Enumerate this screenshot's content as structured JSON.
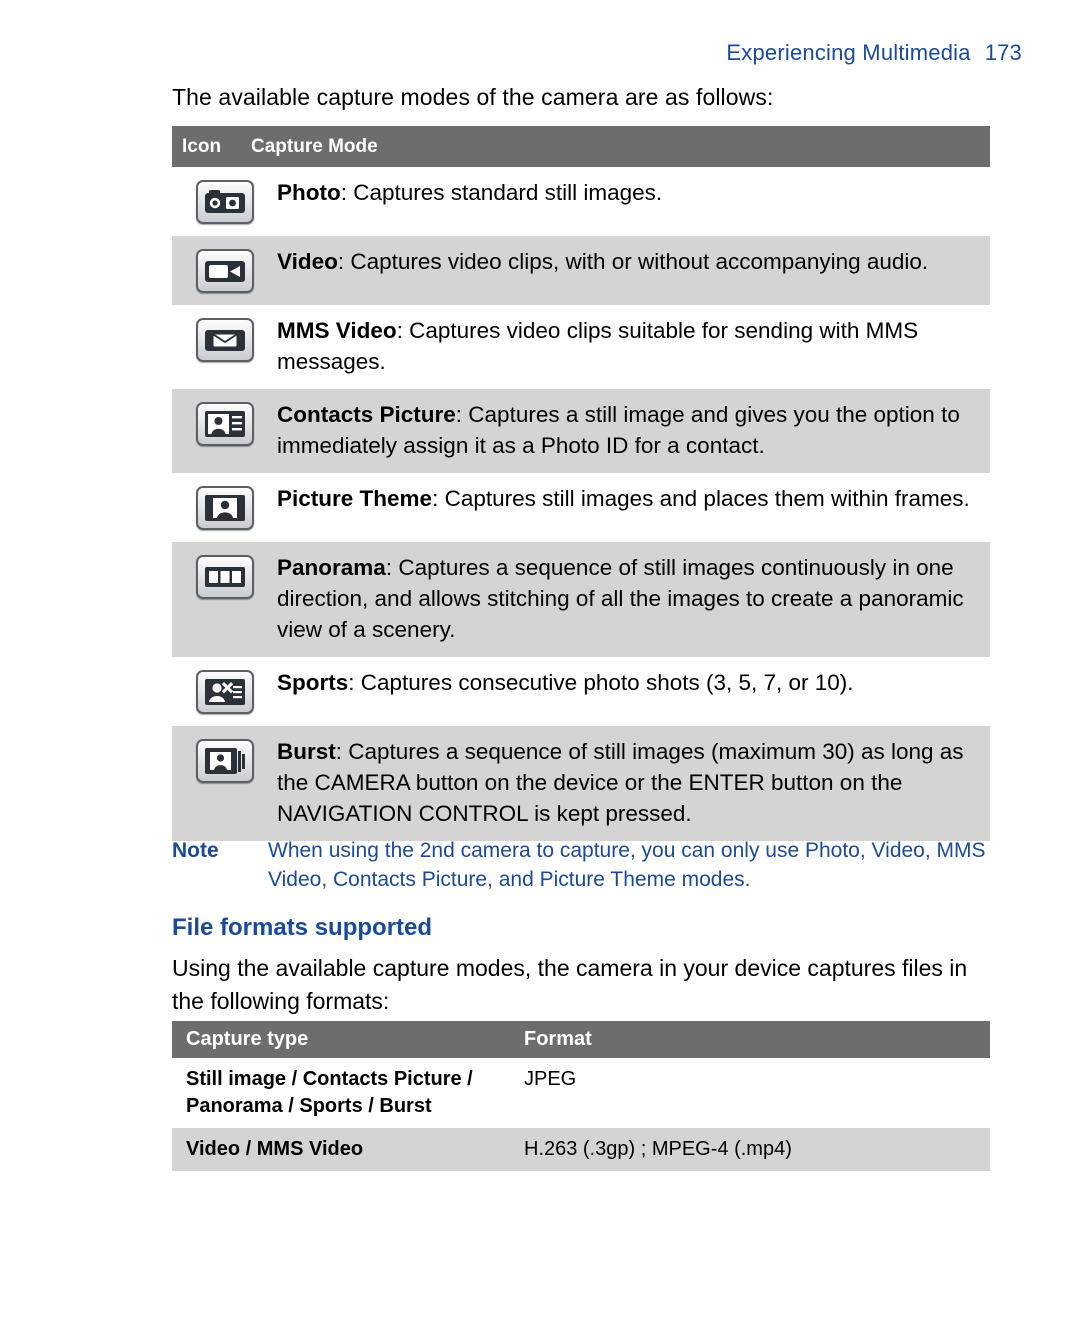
{
  "header": {
    "chapter": "Experiencing Multimedia",
    "page_number": "173"
  },
  "intro": "The available capture modes of the camera are as follows:",
  "modes_table": {
    "headers": {
      "icon": "Icon",
      "mode": "Capture Mode"
    },
    "rows": [
      {
        "icon_name": "photo-camera-icon",
        "term": "Photo",
        "text": ": Captures standard still images."
      },
      {
        "icon_name": "video-camera-icon",
        "term": "Video",
        "text": ": Captures video clips, with or without accompanying audio."
      },
      {
        "icon_name": "mms-video-icon",
        "term": "MMS Video",
        "text": ": Captures video clips suitable for sending with MMS messages."
      },
      {
        "icon_name": "contacts-picture-icon",
        "term": "Contacts Picture",
        "text": ": Captures a still image and gives you the option to immediately assign it as a Photo ID for a contact."
      },
      {
        "icon_name": "picture-theme-icon",
        "term": "Picture Theme",
        "text": ": Captures still images and places them within frames."
      },
      {
        "icon_name": "panorama-icon",
        "term": "Panorama",
        "text": ": Captures a sequence of still images continuously in one direction, and allows stitching of all the images to create a panoramic view of a scenery."
      },
      {
        "icon_name": "sports-icon",
        "term": "Sports",
        "text": ": Captures consecutive photo shots (3, 5, 7, or 10)."
      },
      {
        "icon_name": "burst-icon",
        "term": "Burst",
        "text": ": Captures a sequence of still images (maximum 30) as long as the CAMERA button on the device or the ENTER button on the NAVIGATION CONTROL is kept pressed."
      }
    ]
  },
  "note": {
    "label": "Note",
    "text": "When using the 2nd camera to capture, you can only use Photo, Video, MMS Video, Contacts Picture, and Picture Theme modes."
  },
  "section": {
    "heading": "File formats supported",
    "paragraph": "Using the available capture modes, the camera in your device captures files in the following formats:"
  },
  "formats_table": {
    "headers": {
      "capture_type": "Capture type",
      "format": "Format"
    },
    "rows": [
      {
        "capture_type": "Still image / Contacts Picture / Panorama / Sports / Burst",
        "format": "JPEG"
      },
      {
        "capture_type": "Video / MMS Video",
        "format": "H.263 (.3gp) ; MPEG-4 (.mp4)"
      }
    ]
  },
  "colors": {
    "heading_blue": "#1b4a9c",
    "table_header_gray": "#6d6d6d",
    "row_shade": "#d4d4d4"
  }
}
